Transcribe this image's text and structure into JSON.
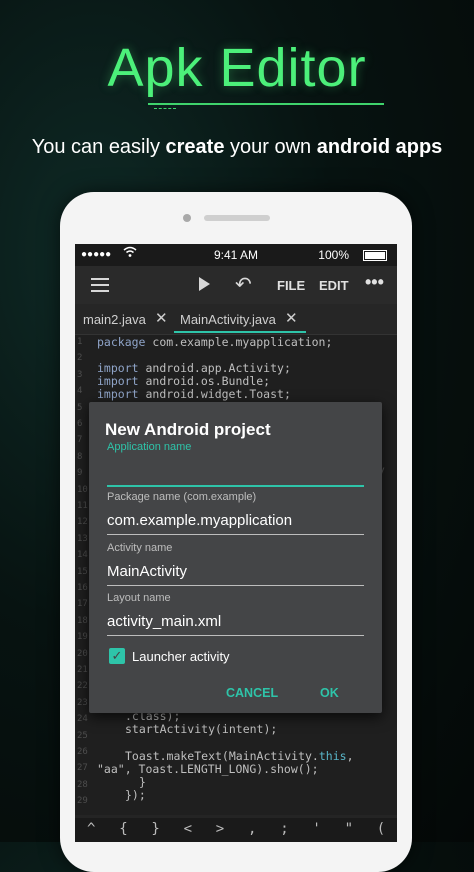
{
  "promo": {
    "title": "Apk Editor",
    "tagline_1": "You can easily ",
    "tagline_2": "create",
    "tagline_3": " your own ",
    "tagline_4": "android apps"
  },
  "statusbar": {
    "signal": "●●●●●",
    "time": "9:41 AM",
    "battery": "100%"
  },
  "toolbar": {
    "file": "FILE",
    "edit": "EDIT",
    "more": "•••",
    "undo_glyph": "↶"
  },
  "tabs": [
    {
      "label": "main2.java",
      "close": "✕"
    },
    {
      "label": "MainActivity.java",
      "close": "✕",
      "active": true
    }
  ],
  "editor": {
    "line_numbers": [
      "1",
      "2",
      "3",
      "4",
      "5",
      "6",
      "7",
      "8",
      "9",
      "10",
      "11",
      "12",
      "13",
      "14",
      "15",
      "16",
      "17",
      "18",
      "19",
      "20",
      "21",
      "22",
      "23",
      "24",
      "25",
      "26",
      "27",
      "28",
      "29"
    ],
    "top_lines": {
      "l1_kw": "package",
      "l1_rest": " com.example.myapplication;",
      "l3_kw": "import",
      "l3_rest": " android.app.Activity;",
      "l4_kw": "import",
      "l4_rest": " android.os.Bundle;",
      "l5_kw": "import",
      "l5_rest": " android.widget.Toast;",
      "hidden_fragment": "ty"
    },
    "bottom_lines": {
      "l1": ".class);",
      "l2": "startActivity(intent);",
      "l3_a": "Toast.makeText(MainActivity.",
      "l3_b": "this",
      "l3_c": ",",
      "l4": "\"aa\", Toast.LENGTH_LONG).show();",
      "l5": "}",
      "l6": "});"
    }
  },
  "keybar": [
    "^",
    "{",
    "}",
    "<",
    ">",
    ",",
    ";",
    "'",
    "\"",
    "("
  ],
  "dialog": {
    "title": "New Android project",
    "app_name_label": "Application name",
    "app_name_value": "",
    "package_label": "Package name (com.example)",
    "package_value": "com.example.myapplication",
    "activity_label": "Activity name",
    "activity_value": "MainActivity",
    "layout_label": "Layout name",
    "layout_value": "activity_main.xml",
    "launcher_label": "Launcher activity",
    "launcher_checked": true,
    "cancel": "CANCEL",
    "ok": "OK"
  },
  "colors": {
    "title_green": "#4cf07a",
    "accent_teal": "#2ec4a9",
    "dialog_bg": "#444547",
    "editor_bg": "#1f1f1f"
  }
}
